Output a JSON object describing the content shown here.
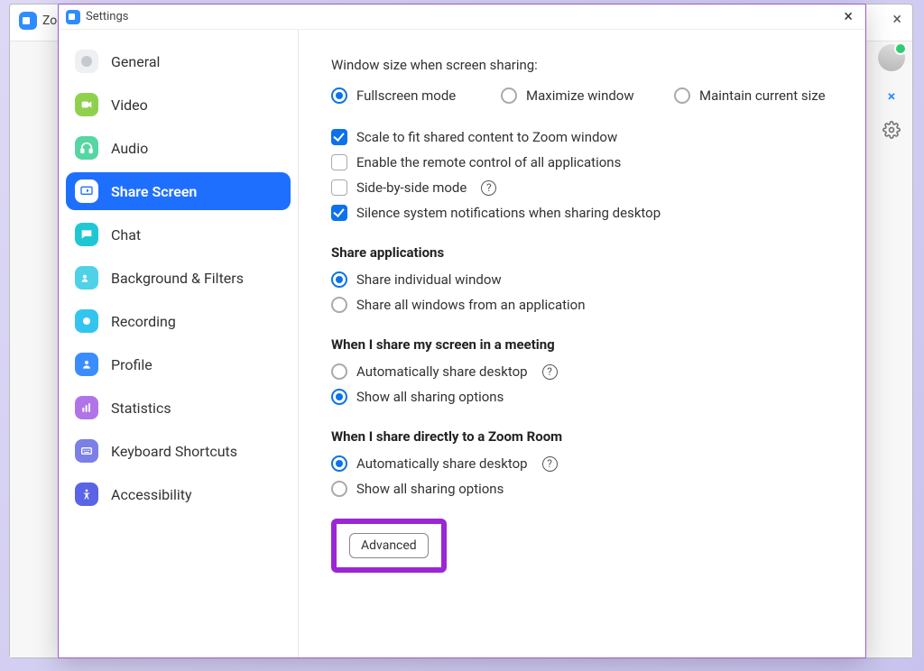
{
  "bg": {
    "title": "Zoo"
  },
  "settings_window": {
    "title": "Settings"
  },
  "sidebar": {
    "items": [
      {
        "label": "General"
      },
      {
        "label": "Video"
      },
      {
        "label": "Audio"
      },
      {
        "label": "Share Screen"
      },
      {
        "label": "Chat"
      },
      {
        "label": "Background & Filters"
      },
      {
        "label": "Recording"
      },
      {
        "label": "Profile"
      },
      {
        "label": "Statistics"
      },
      {
        "label": "Keyboard Shortcuts"
      },
      {
        "label": "Accessibility"
      }
    ],
    "active_index": 3
  },
  "content": {
    "window_size_label": "Window size when screen sharing:",
    "window_size_options": {
      "fullscreen": "Fullscreen mode",
      "maximize": "Maximize window",
      "maintain": "Maintain current size",
      "selected": "fullscreen"
    },
    "checkboxes": {
      "scale_fit": {
        "label": "Scale to fit shared content to Zoom window",
        "checked": true
      },
      "remote_control": {
        "label": "Enable the remote control of all applications",
        "checked": false
      },
      "side_by_side": {
        "label": "Side-by-side mode",
        "checked": false,
        "help": true
      },
      "silence_notif": {
        "label": "Silence system notifications when sharing desktop",
        "checked": true
      }
    },
    "share_apps": {
      "title": "Share applications",
      "opt_individual": "Share individual window",
      "opt_all": "Share all windows from an application",
      "selected": "individual"
    },
    "share_meeting": {
      "title": "When I share my screen in a meeting",
      "opt_auto": "Automatically share desktop",
      "opt_show": "Show all sharing options",
      "selected": "show"
    },
    "share_zoom_room": {
      "title": "When I share directly to a Zoom Room",
      "opt_auto": "Automatically share desktop",
      "opt_show": "Show all sharing options",
      "selected": "auto"
    },
    "advanced_label": "Advanced"
  }
}
